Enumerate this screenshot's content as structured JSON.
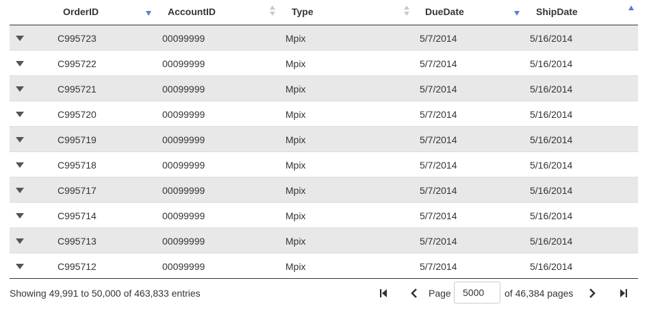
{
  "columns": {
    "order_id": "OrderID",
    "account_id": "AccountID",
    "type": "Type",
    "due_date": "DueDate",
    "ship_date": "ShipDate"
  },
  "rows": [
    {
      "order_id": "C995723",
      "account_id": "00099999",
      "type": "Mpix",
      "due_date": "5/7/2014",
      "ship_date": "5/16/2014"
    },
    {
      "order_id": "C995722",
      "account_id": "00099999",
      "type": "Mpix",
      "due_date": "5/7/2014",
      "ship_date": "5/16/2014"
    },
    {
      "order_id": "C995721",
      "account_id": "00099999",
      "type": "Mpix",
      "due_date": "5/7/2014",
      "ship_date": "5/16/2014"
    },
    {
      "order_id": "C995720",
      "account_id": "00099999",
      "type": "Mpix",
      "due_date": "5/7/2014",
      "ship_date": "5/16/2014"
    },
    {
      "order_id": "C995719",
      "account_id": "00099999",
      "type": "Mpix",
      "due_date": "5/7/2014",
      "ship_date": "5/16/2014"
    },
    {
      "order_id": "C995718",
      "account_id": "00099999",
      "type": "Mpix",
      "due_date": "5/7/2014",
      "ship_date": "5/16/2014"
    },
    {
      "order_id": "C995717",
      "account_id": "00099999",
      "type": "Mpix",
      "due_date": "5/7/2014",
      "ship_date": "5/16/2014"
    },
    {
      "order_id": "C995714",
      "account_id": "00099999",
      "type": "Mpix",
      "due_date": "5/7/2014",
      "ship_date": "5/16/2014"
    },
    {
      "order_id": "C995713",
      "account_id": "00099999",
      "type": "Mpix",
      "due_date": "5/7/2014",
      "ship_date": "5/16/2014"
    },
    {
      "order_id": "C995712",
      "account_id": "00099999",
      "type": "Mpix",
      "due_date": "5/7/2014",
      "ship_date": "5/16/2014"
    }
  ],
  "footer": {
    "info": "Showing 49,991 to 50,000 of 463,833 entries",
    "page_label": "Page",
    "page_value": "5000",
    "of_pages": "of 46,384 pages"
  },
  "icons": {
    "first": "first-page-icon",
    "prev": "previous-page-icon",
    "next": "next-page-icon",
    "last": "last-page-icon",
    "expander": "expand-row-icon"
  },
  "colors": {
    "sort_active": "#5b7ccc",
    "sort_inactive": "#c8c8c8",
    "row_alt": "#e8e8e8"
  }
}
